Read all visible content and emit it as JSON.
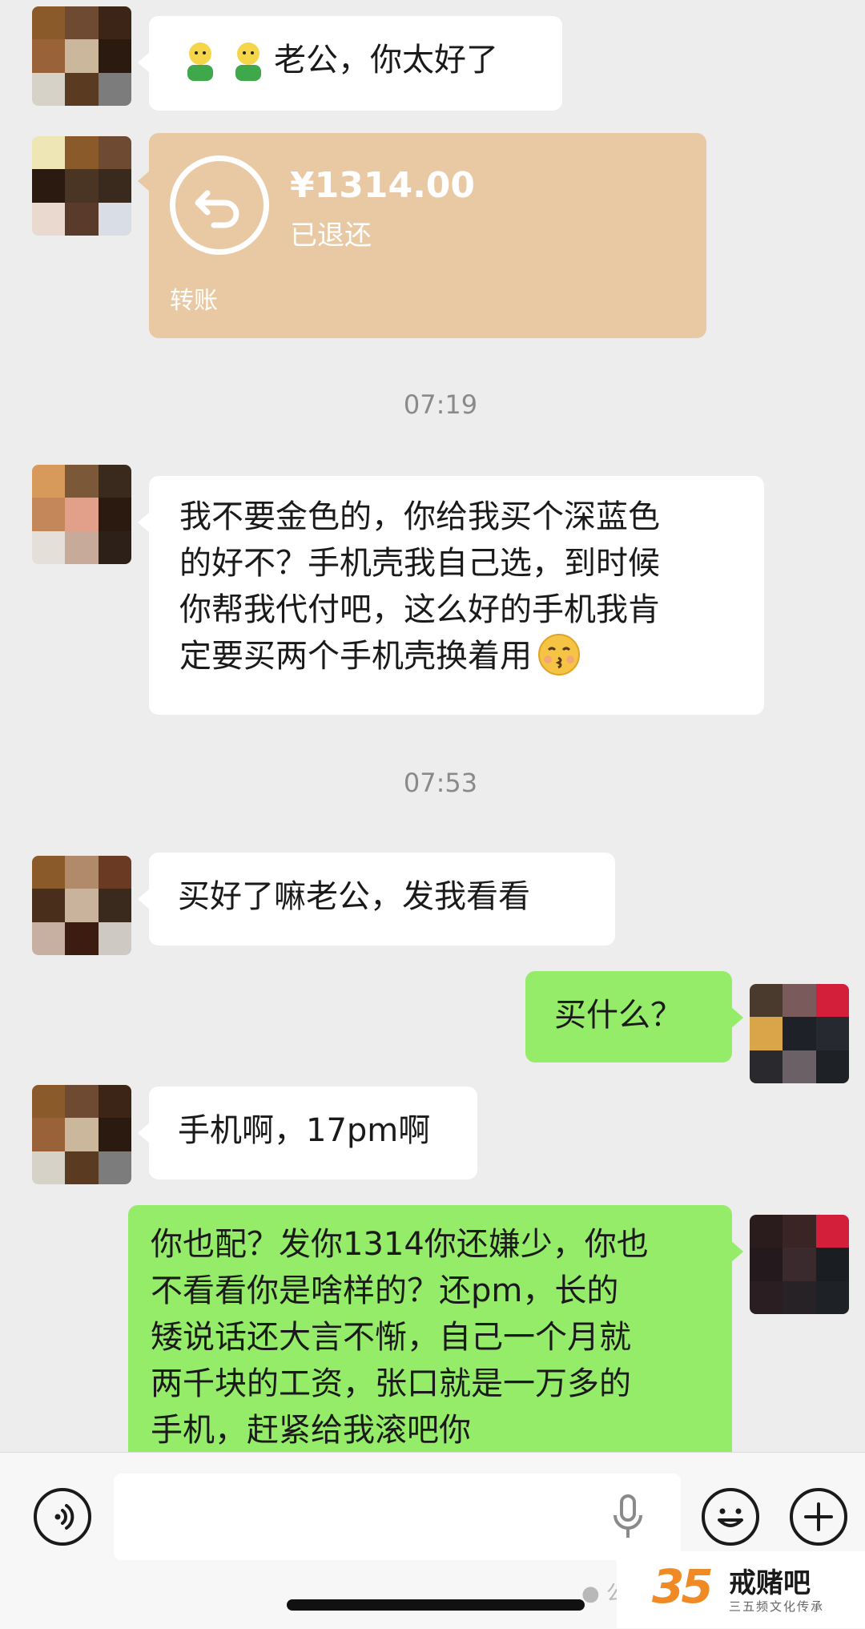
{
  "messages": [
    {
      "side": "left",
      "emoji_count": 2,
      "text": "老公，你太好了"
    },
    {
      "type": "transfer",
      "amount": "¥1314.00",
      "status": "已退还",
      "label": "转账"
    },
    {
      "type": "time",
      "text": "07:19"
    },
    {
      "side": "left",
      "lines": [
        "我不要金色的，你给我买个深蓝色",
        "的好不？手机壳我自己选，到时候",
        "你帮我代付吧，这么好的手机我肯",
        "定要买两个手机壳换着用"
      ]
    },
    {
      "type": "time",
      "text": "07:53"
    },
    {
      "side": "left",
      "text": "买好了嘛老公，发我看看"
    },
    {
      "side": "right",
      "text": "买什么？"
    },
    {
      "side": "left",
      "text": "手机啊，17pm啊"
    },
    {
      "side": "right",
      "lines": [
        "你也配？发你1314你还嫌少，你也",
        "不看看你是啥样的？还pm，长的",
        "矮说话还大言不惭，自己一个月就",
        "两千块的工资，张口就是一万多的",
        "手机，赶紧给我滚吧你"
      ]
    }
  ],
  "input_bar": {
    "voice_icon": "voice-icon",
    "mic_icon": "microphone-icon",
    "emoji_icon": "smiley-icon",
    "plus_icon": "plus-icon"
  },
  "watermark": {
    "number": "35",
    "name": "戒赌吧",
    "sub": "三五频文化传承",
    "account": "公众号"
  },
  "colors": {
    "background": "#ededed",
    "incoming": "#ffffff",
    "outgoing": "#95ec69",
    "transfer": "#e8c9a4"
  }
}
